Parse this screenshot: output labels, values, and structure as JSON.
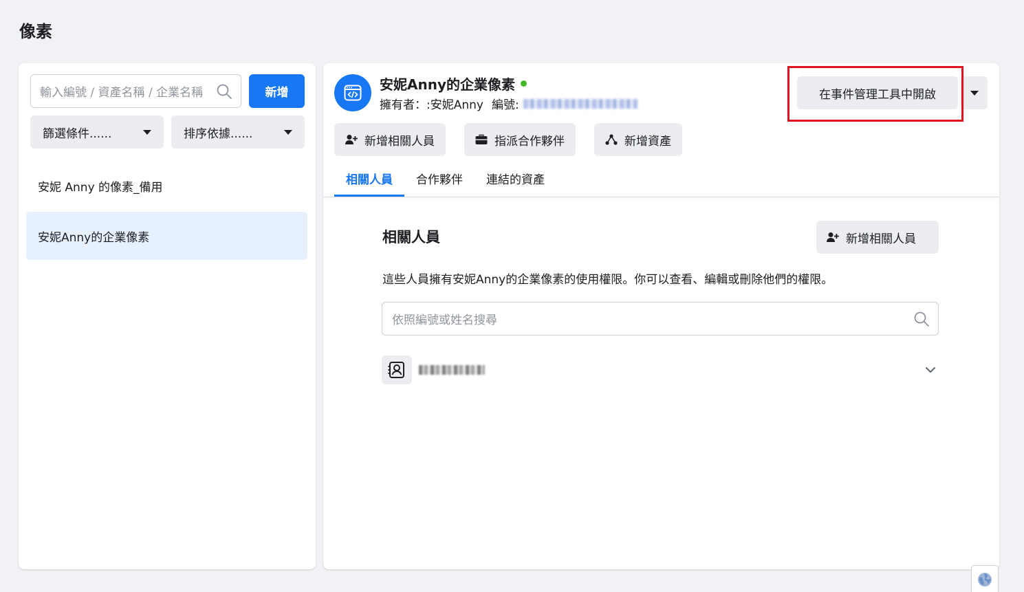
{
  "page": {
    "title": "像素"
  },
  "left_panel": {
    "search_placeholder": "輸入編號 / 資產名稱 / 企業名稱",
    "new_button_label": "新增",
    "filter_label": "篩選條件......",
    "sort_label": "排序依據......",
    "items": [
      {
        "label": "安妮 Anny 的像素_備用",
        "selected": false
      },
      {
        "label": "安妮Anny的企業像素",
        "selected": true
      }
    ]
  },
  "asset": {
    "name": "安妮Anny的企業像素",
    "status": "active",
    "owner_label": "擁有者：:",
    "owner_name": "安妮Anny",
    "id_label": "編號:"
  },
  "toolbar": {
    "open_event_manager_label": "在事件管理工具中開啟",
    "actions": [
      {
        "label": "新增相關人員",
        "icon": "add-person-icon"
      },
      {
        "label": "指派合作夥伴",
        "icon": "briefcase-icon"
      },
      {
        "label": "新增資產",
        "icon": "connect-assets-icon"
      }
    ]
  },
  "tabs": [
    {
      "label": "相關人員",
      "active": true
    },
    {
      "label": "合作夥伴",
      "active": false
    },
    {
      "label": "連結的資產",
      "active": false
    }
  ],
  "people_section": {
    "title": "相關人員",
    "add_button_label": "新增相關人員",
    "description": "這些人員擁有安妮Anny的企業像素的使用權限。你可以查看、編輯或刪除他們的權限。",
    "search_placeholder": "依照編號或姓名搜尋"
  },
  "colors": {
    "accent": "#1877f2",
    "highlight_border": "#e0141e",
    "status_active": "#42b72a",
    "selected_bg": "#e7f0fd"
  }
}
